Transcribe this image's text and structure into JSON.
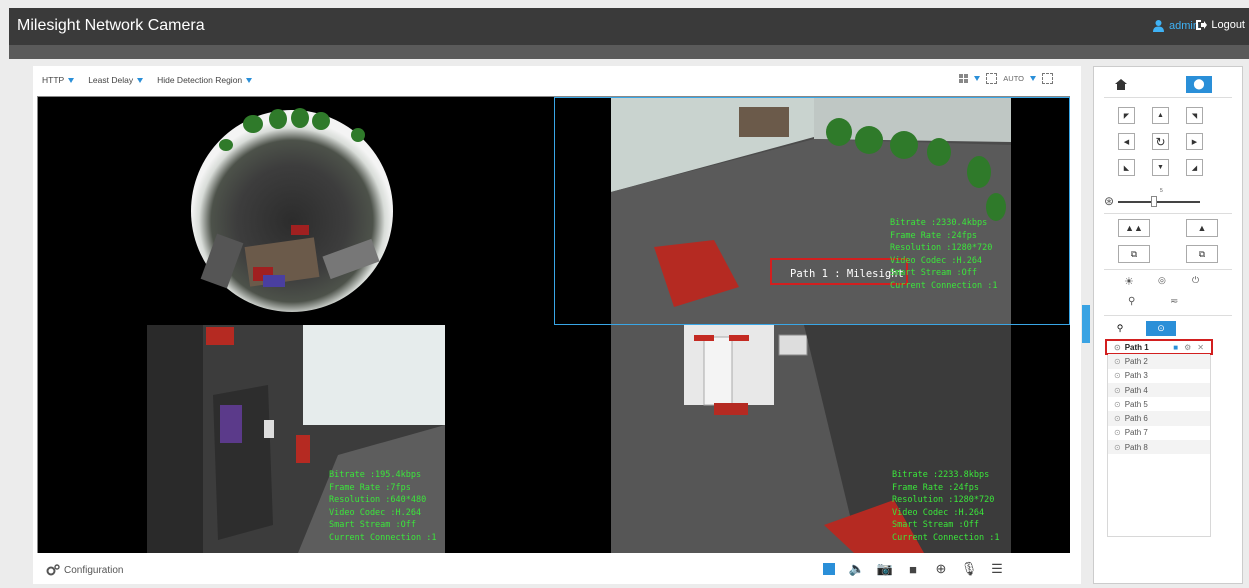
{
  "header": {
    "title": "Milesight Network Camera",
    "user": "admin",
    "logout": "Logout"
  },
  "toolbar": {
    "protocol": "HTTP",
    "delay": "Least Delay",
    "detection": "Hide Detection Region",
    "stream_mode": "AUTO"
  },
  "views": [
    {
      "id": "fisheye",
      "osd": ""
    },
    {
      "id": "ch2",
      "path_label": "Path 1 : Milesight",
      "osd": "Bitrate :2330.4kbps\nFrame Rate :24fps\nResolution :1280*720\nVideo Codec :H.264\nSmart Stream :Off\nCurrent Connection :1"
    },
    {
      "id": "ch3",
      "osd": "Bitrate :195.4kbps\nFrame Rate :7fps\nResolution :640*480\nVideo Codec :H.264\nSmart Stream :Off\nCurrent Connection :1"
    },
    {
      "id": "ch4",
      "osd": "Bitrate :2233.8kbps\nFrame Rate :24fps\nResolution :1280*720\nVideo Codec :H.264\nSmart Stream :Off\nCurrent Connection :1"
    }
  ],
  "footer": {
    "configuration": "Configuration"
  },
  "ptz": {
    "speed": "5",
    "paths": [
      "Path 1",
      "Path 2",
      "Path 3",
      "Path 4",
      "Path 5",
      "Path 6",
      "Path 7",
      "Path 8"
    ],
    "selected_path": 0
  },
  "colors": {
    "accent": "#3aa3e3",
    "header": "#3a3a3a",
    "highlight": "#d21f1f",
    "osd": "#3be63b"
  }
}
